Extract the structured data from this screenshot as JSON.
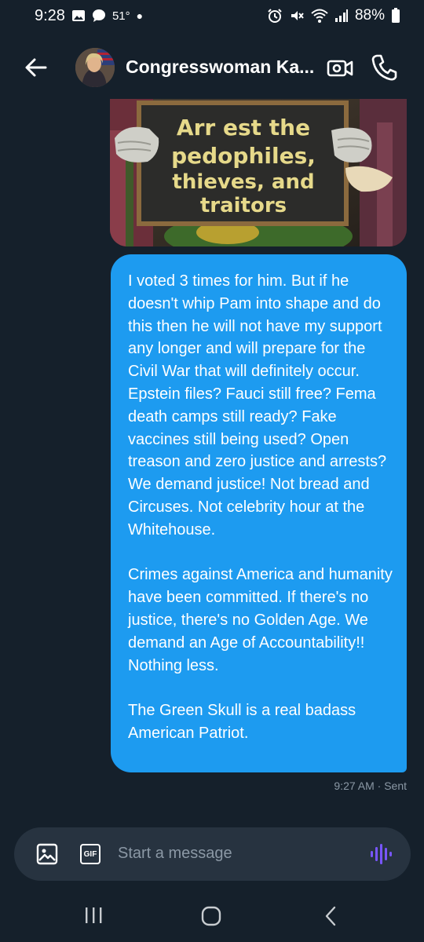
{
  "status_bar": {
    "time": "9:28",
    "temperature": "51°",
    "battery": "88%"
  },
  "header": {
    "title": "Congresswoman Ka...",
    "icons": [
      "back-arrow-icon",
      "video-camera-icon",
      "phone-icon"
    ]
  },
  "image_message": {
    "sign_lines": [
      "Arr est the",
      "pedophiles,",
      "thieves, and",
      "traitors"
    ]
  },
  "message": {
    "paragraphs": [
      "I voted 3 times for him. But if he doesn't whip Pam into shape and do this then he will not have my support any longer and will prepare for the Civil War that will definitely occur. Epstein files? Fauci still free? Fema death camps still ready? Fake vaccines still being used? Open treason and zero justice and arrests? We demand justice! Not bread and Circuses. Not celebrity hour at the Whitehouse.",
      "Crimes against America and humanity have been committed. If there's no justice, there's no Golden Age. We demand an Age of Accountability!! Nothing less.",
      "The Green Skull is a real badass American Patriot."
    ],
    "meta": "9:27 AM · Sent"
  },
  "composer": {
    "placeholder": "Start a message",
    "gif_label": "GIF"
  },
  "colors": {
    "background": "#15202b",
    "bubble": "#1d9bf0",
    "composer": "#273340",
    "accent_voice": "#7856ff",
    "muted": "#8b98a5"
  }
}
